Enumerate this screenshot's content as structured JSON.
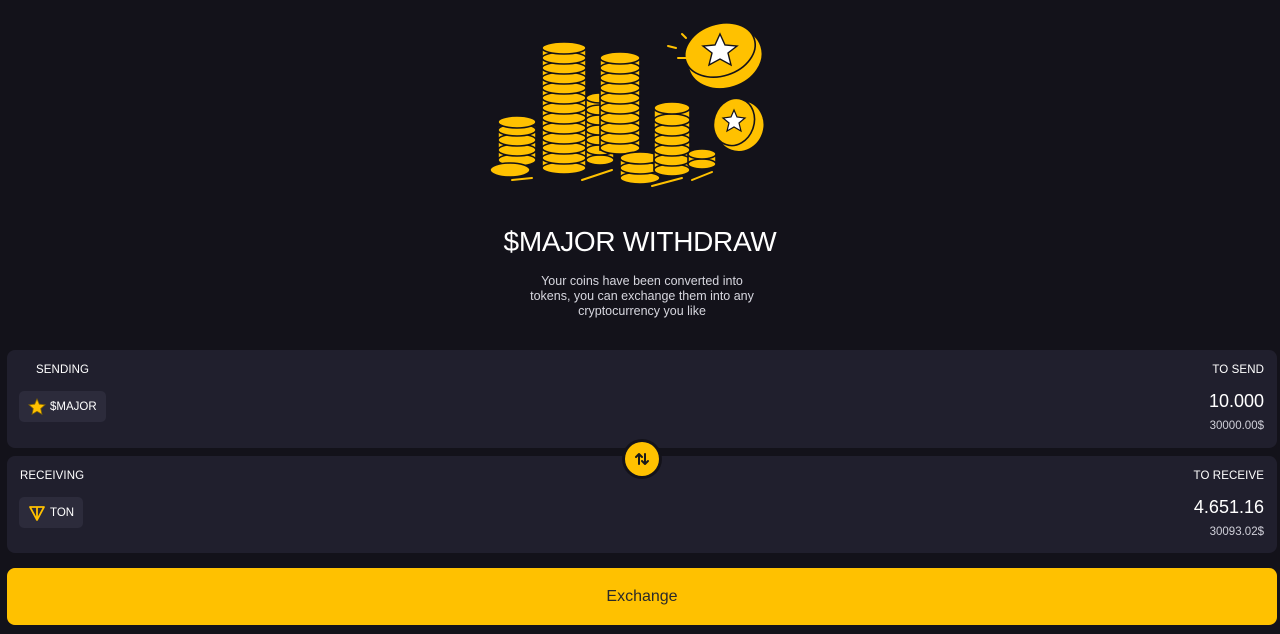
{
  "hero": {
    "title": "$MAJOR WITHDRAW",
    "subtitle": "Your coins have been converted into tokens, you can exchange them into any cryptocurrency you like",
    "illustration_icon": "coin-stacks-illustration"
  },
  "sending": {
    "label": "SENDING",
    "right_label": "TO SEND",
    "token": {
      "icon": "star-icon",
      "name": "$MAJOR"
    },
    "amount": "10.000",
    "fiat": "30000.00$"
  },
  "receiving": {
    "label": "RECEIVING",
    "right_label": "TO RECEIVE",
    "token": {
      "icon": "ton-icon",
      "name": "TON"
    },
    "amount": "4.651.16",
    "fiat": "30093.02$"
  },
  "swap": {
    "icon": "swap-arrows-icon"
  },
  "action": {
    "exchange_label": "Exchange"
  },
  "colors": {
    "background": "#13121a",
    "card": "#201f2d",
    "chip": "#2c2b3b",
    "accent": "#ffc100"
  }
}
